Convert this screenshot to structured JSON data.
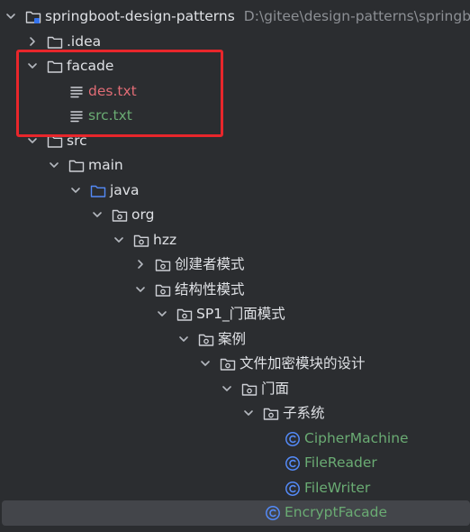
{
  "project": {
    "name": "springboot-design-patterns",
    "path": "D:\\gitee\\design-patterns\\springbo"
  },
  "tree": [
    {
      "label": "springboot-design-patterns",
      "indent": 0,
      "expanded": true,
      "type": "folder-module",
      "color": "default",
      "is_root": true
    },
    {
      "label": ".idea",
      "indent": 1,
      "expanded": false,
      "type": "folder",
      "color": "default"
    },
    {
      "label": "facade",
      "indent": 1,
      "expanded": true,
      "type": "folder",
      "color": "default"
    },
    {
      "label": "des.txt",
      "indent": 2,
      "type": "text-file",
      "color": "red"
    },
    {
      "label": "src.txt",
      "indent": 2,
      "type": "text-file",
      "color": "green"
    },
    {
      "label": "src",
      "indent": 1,
      "expanded": true,
      "type": "folder",
      "color": "default"
    },
    {
      "label": "main",
      "indent": 2,
      "expanded": true,
      "type": "folder",
      "color": "default"
    },
    {
      "label": "java",
      "indent": 3,
      "expanded": true,
      "type": "source-folder",
      "color": "default"
    },
    {
      "label": "org",
      "indent": 4,
      "expanded": true,
      "type": "package",
      "color": "default"
    },
    {
      "label": "hzz",
      "indent": 5,
      "expanded": true,
      "type": "package",
      "color": "default"
    },
    {
      "label": "创建者模式",
      "indent": 6,
      "expanded": false,
      "type": "package",
      "color": "default"
    },
    {
      "label": "结构性模式",
      "indent": 6,
      "expanded": true,
      "type": "package",
      "color": "default"
    },
    {
      "label": "SP1_门面模式",
      "indent": 7,
      "expanded": true,
      "type": "package",
      "color": "default"
    },
    {
      "label": "案例",
      "indent": 8,
      "expanded": true,
      "type": "package",
      "color": "default"
    },
    {
      "label": "文件加密模块的设计",
      "indent": 9,
      "expanded": true,
      "type": "package",
      "color": "default"
    },
    {
      "label": "门面",
      "indent": 10,
      "expanded": true,
      "type": "package",
      "color": "default"
    },
    {
      "label": "子系统",
      "indent": 11,
      "expanded": true,
      "type": "package",
      "color": "default"
    },
    {
      "label": "CipherMachine",
      "indent": 12,
      "type": "class",
      "color": "green"
    },
    {
      "label": "FileReader",
      "indent": 12,
      "type": "class",
      "color": "green"
    },
    {
      "label": "FileWriter",
      "indent": 12,
      "type": "class",
      "color": "green"
    },
    {
      "label": "EncryptFacade",
      "indent": 11,
      "type": "class",
      "color": "green",
      "selected": true
    }
  ],
  "colors": {
    "background": "#2b2d30",
    "selected": "#43454a",
    "highlight_box": "#e8262b",
    "class_icon": "#548af7",
    "green": "#6aab73",
    "red": "#e06c75"
  }
}
